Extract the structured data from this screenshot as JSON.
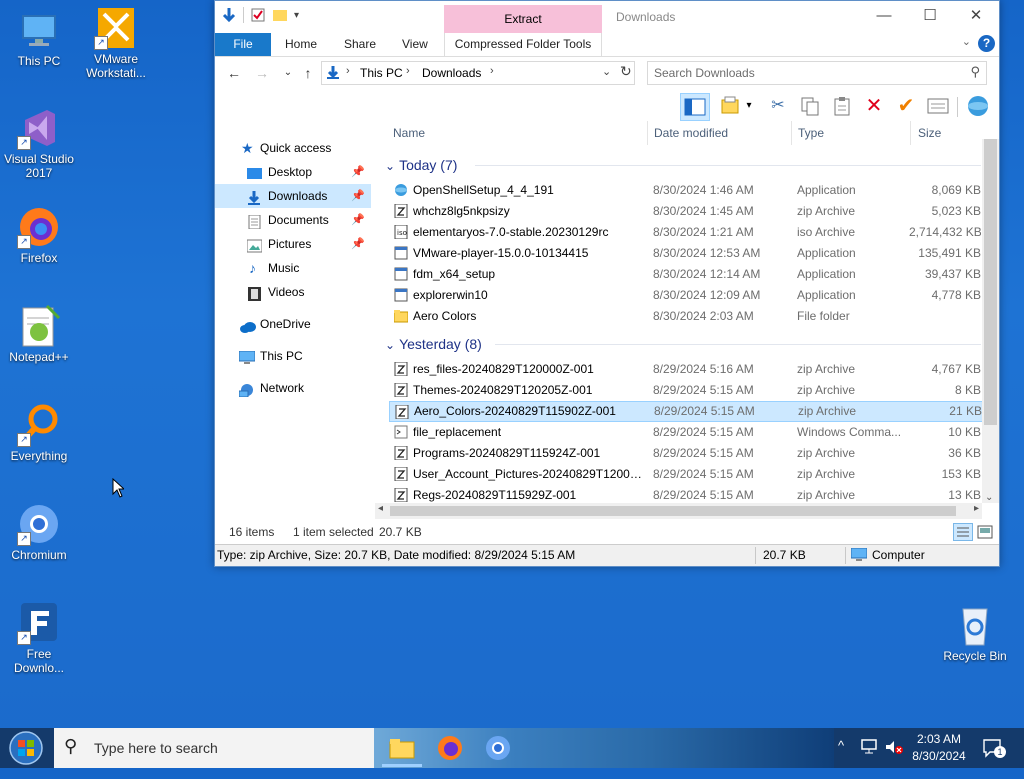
{
  "desktop": {
    "icons": [
      {
        "label": "This PC"
      },
      {
        "label": "VMware Workstati..."
      },
      {
        "label": "Visual Studio 2017"
      },
      {
        "label": "Firefox"
      },
      {
        "label": "Notepad++"
      },
      {
        "label": "Everything"
      },
      {
        "label": "Chromium"
      },
      {
        "label": "Free Downlo..."
      },
      {
        "label": "Recycle Bin"
      }
    ]
  },
  "explorer": {
    "title": "Downloads",
    "context_tab": "Extract",
    "ribbon_tabs": {
      "file": "File",
      "home": "Home",
      "share": "Share",
      "view": "View",
      "compressed": "Compressed Folder Tools"
    },
    "help": "?",
    "address": {
      "crumbs": [
        "This PC",
        "Downloads"
      ]
    },
    "search_placeholder": "Search Downloads",
    "nav": {
      "quick_access": "Quick access",
      "desktop": "Desktop",
      "downloads": "Downloads",
      "documents": "Documents",
      "pictures": "Pictures",
      "music": "Music",
      "videos": "Videos",
      "onedrive": "OneDrive",
      "thispc": "This PC",
      "network": "Network"
    },
    "columns": {
      "name": "Name",
      "date": "Date modified",
      "type": "Type",
      "size": "Size"
    },
    "groups": {
      "today": "Today (7)",
      "yesterday": "Yesterday (8)"
    },
    "today_files": [
      {
        "name": "OpenShellSetup_4_4_191",
        "date": "8/30/2024 1:46 AM",
        "type": "Application",
        "size": "8,069 KB"
      },
      {
        "name": "whchz8lg5nkpsizy",
        "date": "8/30/2024 1:45 AM",
        "type": "zip Archive",
        "size": "5,023 KB"
      },
      {
        "name": "elementaryos-7.0-stable.20230129rc",
        "date": "8/30/2024 1:21 AM",
        "type": "iso Archive",
        "size": "2,714,432 KB"
      },
      {
        "name": "VMware-player-15.0.0-10134415",
        "date": "8/30/2024 12:53 AM",
        "type": "Application",
        "size": "135,491 KB"
      },
      {
        "name": "fdm_x64_setup",
        "date": "8/30/2024 12:14 AM",
        "type": "Application",
        "size": "39,437 KB"
      },
      {
        "name": "explorerwin10",
        "date": "8/30/2024 12:09 AM",
        "type": "Application",
        "size": "4,778 KB"
      },
      {
        "name": "Aero Colors",
        "date": "8/30/2024 2:03 AM",
        "type": "File folder",
        "size": ""
      }
    ],
    "yesterday_files": [
      {
        "name": "res_files-20240829T120000Z-001",
        "date": "8/29/2024 5:16 AM",
        "type": "zip Archive",
        "size": "4,767 KB"
      },
      {
        "name": "Themes-20240829T120205Z-001",
        "date": "8/29/2024 5:15 AM",
        "type": "zip Archive",
        "size": "8 KB"
      },
      {
        "name": "Aero_Colors-20240829T115902Z-001",
        "date": "8/29/2024 5:15 AM",
        "type": "zip Archive",
        "size": "21 KB"
      },
      {
        "name": "file_replacement",
        "date": "8/29/2024 5:15 AM",
        "type": "Windows Comma...",
        "size": "10 KB"
      },
      {
        "name": "Programs-20240829T115924Z-001",
        "date": "8/29/2024 5:15 AM",
        "type": "zip Archive",
        "size": "36 KB"
      },
      {
        "name": "User_Account_Pictures-20240829T120017...",
        "date": "8/29/2024 5:15 AM",
        "type": "zip Archive",
        "size": "153 KB"
      },
      {
        "name": "Regs-20240829T115929Z-001",
        "date": "8/29/2024 5:15 AM",
        "type": "zip Archive",
        "size": "13 KB"
      }
    ],
    "status": {
      "items": "16 items",
      "selected": "1 item selected",
      "sel_size": "20.7 KB",
      "details": "Type: zip Archive, Size: 20.7 KB, Date modified: 8/29/2024 5:15 AM",
      "size2": "20.7 KB",
      "computer": "Computer"
    }
  },
  "taskbar": {
    "search_placeholder": "Type here to search",
    "time": "2:03 AM",
    "date": "8/30/2024",
    "notifications": "1"
  }
}
